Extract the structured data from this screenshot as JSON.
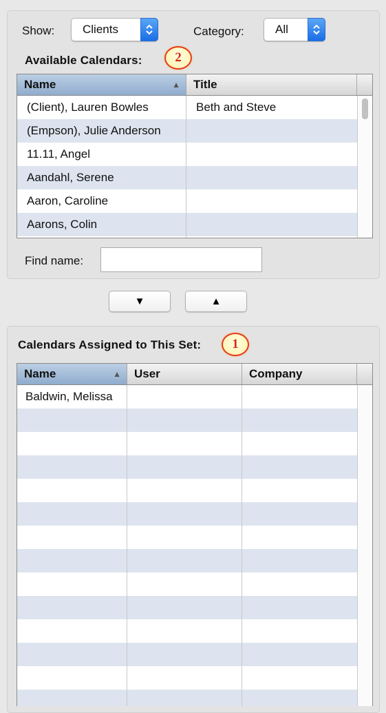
{
  "filters": {
    "show_label": "Show:",
    "show_value": "Clients",
    "category_label": "Category:",
    "category_value": "All"
  },
  "available": {
    "heading": "Available Calendars:",
    "badge": "2",
    "columns": [
      "Name",
      "Title"
    ],
    "rows": [
      [
        "(Client), Lauren Bowles",
        "Beth and Steve"
      ],
      [
        "(Empson), Julie Anderson",
        ""
      ],
      [
        "11.11, Angel",
        ""
      ],
      [
        "Aandahl, Serene",
        ""
      ],
      [
        "Aaron, Caroline",
        ""
      ],
      [
        "Aarons, Colin",
        ""
      ]
    ],
    "find_label": "Find name:",
    "find_value": ""
  },
  "move_buttons": {
    "down": "▼",
    "up": "▲"
  },
  "assigned": {
    "heading": "Calendars Assigned to This Set:",
    "badge": "1",
    "columns": [
      "Name",
      "User",
      "Company"
    ],
    "rows": [
      [
        "Baldwin, Melissa",
        "",
        ""
      ]
    ]
  },
  "colors": {
    "badge_border": "#e83a18",
    "badge_text": "#d72b0d",
    "row_alt": "#dde4ef",
    "popup_arrow": "#2a7cf0"
  }
}
